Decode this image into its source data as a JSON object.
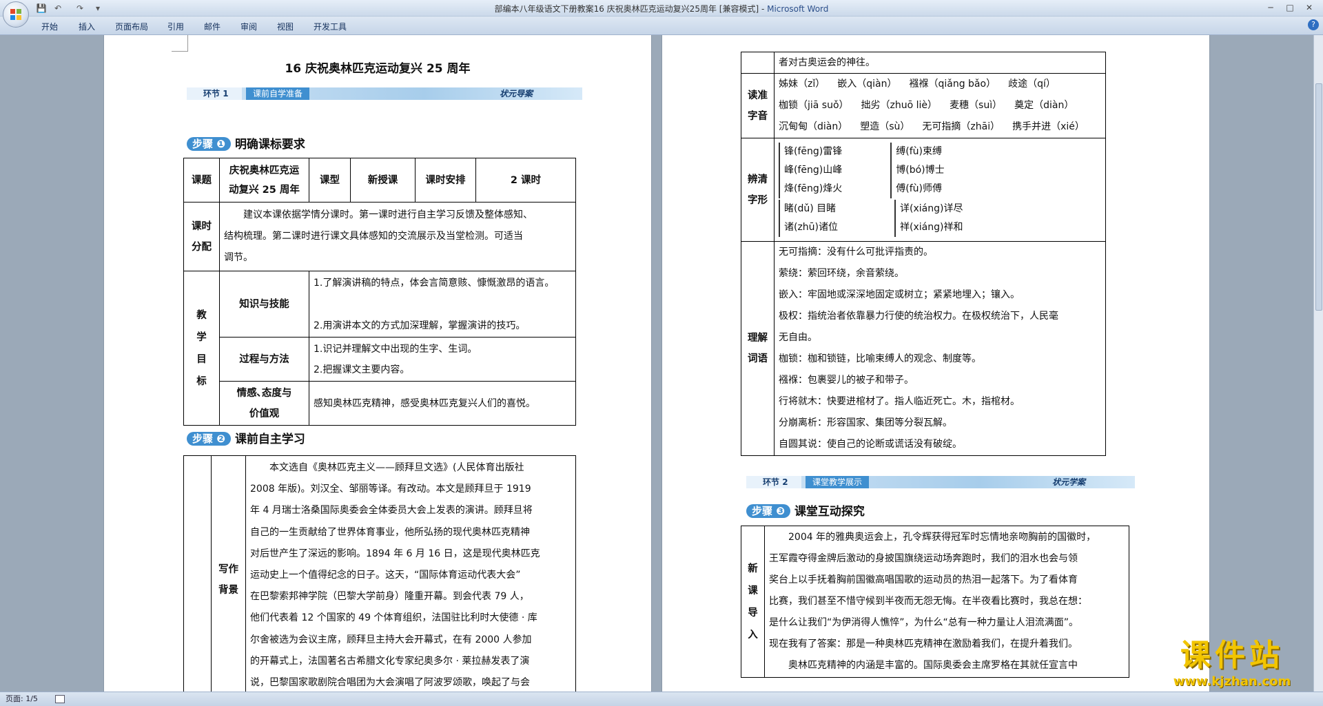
{
  "window": {
    "title": "部编本八年级语文下册教案16 庆祝奥林匹克运动复兴25周年 [兼容模式]",
    "app": "Microsoft Word",
    "controls": {
      "minimize": "─",
      "maximize": "□",
      "close": "✕"
    }
  },
  "quick_access": {
    "save": "💾",
    "undo": "↶",
    "redo": "↷",
    "more": "▾"
  },
  "ribbon": {
    "tabs": [
      "开始",
      "插入",
      "页面布局",
      "引用",
      "邮件",
      "审阅",
      "视图",
      "开发工具"
    ],
    "help": "?"
  },
  "status": {
    "page": "页面: 1/5"
  },
  "page1": {
    "title": "16  庆祝奥林匹克运动复兴 25 周年",
    "banner1": {
      "label": "环节",
      "num": "1",
      "topic": "课前自学准备",
      "tag": "状元导案"
    },
    "step1": {
      "num": "步骤 ❶",
      "text": "明确课标要求"
    },
    "table1": {
      "r1": {
        "c1": "课题",
        "c2a": "庆祝奥林匹克运",
        "c2b": "动复兴 25 周年",
        "c3": "课型",
        "c4": "新授课",
        "c5": "课时安排",
        "c6": "2 课时"
      },
      "r2": {
        "label_a": "课时",
        "label_b": "分配",
        "l1": "建议本课依据学情分课时。第一课时进行自主学习反馈及整体感知、",
        "l2": "结构梳理。第二课时进行课文具体感知的交流展示及当堂检测。可适当",
        "l3": "调节。"
      },
      "goals_label": "教学目标",
      "g1": {
        "label": "知识与技能",
        "t1": "1.了解演讲稿的特点，体会言简意赅、慷慨激昂的语言。",
        "t2": "2.用演讲本文的方式加深理解，掌握演讲的技巧。"
      },
      "g2": {
        "label": "过程与方法",
        "t1": "1.识记并理解文中出现的生字、生词。",
        "t2": "2.把握课文主要内容。"
      },
      "g3": {
        "label_a": "情感､态度与",
        "label_b": "价值观",
        "t1": "感知奥林匹克精神，感受奥林匹克复兴人们的喜悦。"
      }
    },
    "step2": {
      "num": "步骤 ❷",
      "text": "课前自主学习"
    },
    "table2": {
      "label_a": "写作",
      "label_b": "背景",
      "lines": [
        "本文选自《奥林匹克主义——顾拜旦文选》(人民体育出版社",
        "2008 年版)。刘汉全、邹丽等译。有改动。本文是顾拜旦于 1919",
        "年 4 月瑞士洛桑国际奥委会全体委员大会上发表的演讲。顾拜旦将",
        "自己的一生贡献给了世界体育事业，他所弘扬的现代奥林匹克精神",
        "对后世产生了深远的影响。1894 年 6 月 16 日，这是现代奥林匹克",
        "运动史上一个值得纪念的日子。这天，“国际体育运动代表大会”",
        "在巴黎索邦神学院（巴黎大学前身）隆重开幕。到会代表 79 人，",
        "他们代表着 12 个国家的 49 个体育组织，法国驻比利时大使德 · 库",
        "尔舍被选为会议主席，顾拜旦主持大会开幕式，在有 2000 人参加",
        "的开幕式上，法国著名古希腊文化专家纪奥多尔 · 莱拉赫发表了演",
        "说，巴黎国家歌剧院合唱团为大会演唱了阿波罗颂歌，唤起了与会"
      ]
    }
  },
  "page2": {
    "top_line": "者对古奥运会的神往。",
    "read": {
      "label_a": "读准",
      "label_b": "字音",
      "rows": [
        [
          "姊妹（zǐ）",
          "嵌入（qiàn）",
          "襁褓（qiǎng bǎo）",
          "歧途（qí）"
        ],
        [
          "枷锁（jiā suǒ）",
          "拙劣（zhuō liè）",
          "麦穗（suì）",
          "奠定（diàn）"
        ],
        [
          "沉甸甸（diàn）",
          "塑造（sù）",
          "无可指摘（zhāi）",
          "携手并进（xié）"
        ]
      ]
    },
    "shape": {
      "label_a": "辨清",
      "label_b": "字形",
      "g1": [
        "锋(fēng)雷锋",
        "峰(fēng)山峰",
        "烽(fēng)烽火"
      ],
      "g2": [
        "缚(fù)束缚",
        "博(bó)博士",
        "傅(fù)师傅"
      ],
      "g3": [
        "睹(dǔ) 目睹",
        "诸(zhū)诸位"
      ],
      "g4": [
        "详(xiáng)详尽",
        "祥(xiáng)祥和"
      ]
    },
    "words": {
      "label_a": "理解",
      "label_b": "词语",
      "lines": [
        "无可指摘：没有什么可批评指责的。",
        "萦绕：萦回环绕，余音萦绕。",
        "嵌入：牢固地或深深地固定或树立；紧紧地埋入；镶入。",
        "极权：指统治者依靠暴力行使的统治权力。在极权统治下，人民毫",
        "无自由。",
        "枷锁：枷和锁链，比喻束缚人的观念、制度等。",
        "襁褓：包裹婴儿的被子和带子。",
        "行将就木：快要进棺材了。指人临近死亡。木，指棺材。",
        "分崩离析：形容国家、集团等分裂瓦解。",
        "自圆其说：使自己的论断或谎话没有破绽。"
      ]
    },
    "banner2": {
      "label": "环节",
      "num": "2",
      "topic": "课堂教学展示",
      "tag": "状元学案"
    },
    "step3": {
      "num": "步骤 ❸",
      "text": "课堂互动探究"
    },
    "intro": {
      "label": "新课导入",
      "lines": [
        "2004 年的雅典奥运会上，孔令辉获得冠军时忘情地亲吻胸前的国徽时，",
        "王军霞夺得金牌后激动的身披国旗绕运动场奔跑时，我们的泪水也会与领",
        "奖台上以手抚着胸前国徽高唱国歌的运动员的热泪一起落下。为了看体育",
        "比赛，我们甚至不惜守候到半夜而无怨无悔。在半夜看比赛时，我总在想：",
        "是什么让我们“为伊消得人憔悴”，为什么“总有一种力量让人泪流满面”。",
        "现在我有了答案：那是一种奥林匹克精神在激励着我们，在提升着我们。",
        "奥林匹克精神的内涵是丰富的。国际奥委会主席罗格在其就任宣言中"
      ]
    }
  },
  "watermark": {
    "big": "课件站",
    "small": "www.kjzhan.com"
  }
}
